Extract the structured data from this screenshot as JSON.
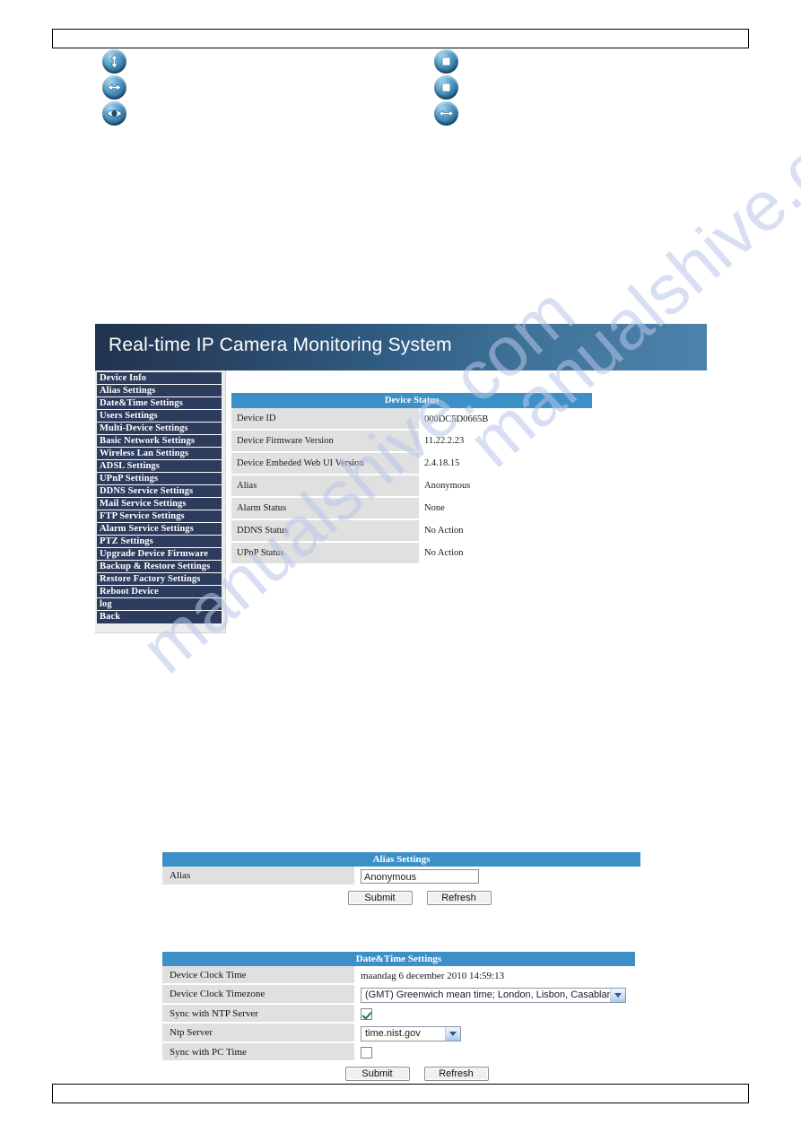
{
  "page": {
    "header_box_text": "",
    "footer_box_text": "",
    "watermark": "manualshive.com"
  },
  "toolbar_icons": {
    "left_group": [
      {
        "name": "vertical-arrow-icon",
        "glyph": "updown"
      },
      {
        "name": "horizontal-arrow-icon",
        "glyph": "leftright"
      },
      {
        "name": "eye-icon",
        "glyph": "eye"
      }
    ],
    "right_group": [
      {
        "name": "stop-square-icon",
        "glyph": "square"
      },
      {
        "name": "stop-square-icon",
        "glyph": "square"
      },
      {
        "name": "horizontal-arrow-icon",
        "glyph": "leftright"
      }
    ]
  },
  "webui": {
    "banner_title": "Real-time IP Camera Monitoring System",
    "sidebar": {
      "items": [
        {
          "label": "Device Info"
        },
        {
          "label": "Alias Settings"
        },
        {
          "label": "Date&Time Settings"
        },
        {
          "label": "Users Settings"
        },
        {
          "label": "Multi-Device Settings"
        },
        {
          "label": "Basic Network Settings"
        },
        {
          "label": "Wireless Lan Settings"
        },
        {
          "label": "ADSL Settings"
        },
        {
          "label": "UPnP Settings"
        },
        {
          "label": "DDNS Service Settings"
        },
        {
          "label": "Mail Service Settings"
        },
        {
          "label": "FTP Service Settings"
        },
        {
          "label": "Alarm Service Settings"
        },
        {
          "label": "PTZ Settings"
        },
        {
          "label": "Upgrade Device Firmware"
        },
        {
          "label": "Backup & Restore Settings"
        },
        {
          "label": "Restore Factory Settings"
        },
        {
          "label": "Reboot Device"
        },
        {
          "label": "log"
        },
        {
          "label": "Back"
        }
      ]
    },
    "device_status": {
      "title": "Device Status",
      "rows": [
        {
          "label": "Device ID",
          "value": "000DC5D0665B"
        },
        {
          "label": "Device Firmware Version",
          "value": "11.22.2.23"
        },
        {
          "label": "Device Embeded Web UI Version",
          "value": "2.4.18.15"
        },
        {
          "label": "Alias",
          "value": "Anonymous"
        },
        {
          "label": "Alarm Status",
          "value": "None"
        },
        {
          "label": "DDNS Status",
          "value": "No Action"
        },
        {
          "label": "UPnP Status",
          "value": "No Action"
        }
      ]
    }
  },
  "alias_settings": {
    "title": "Alias Settings",
    "alias_label": "Alias",
    "alias_value": "Anonymous",
    "submit_label": "Submit",
    "refresh_label": "Refresh"
  },
  "datetime_settings": {
    "title": "Date&Time Settings",
    "clock_time_label": "Device Clock Time",
    "clock_time_value": "maandag 6 december 2010 14:59:13",
    "timezone_label": "Device Clock Timezone",
    "timezone_value": "(GMT) Greenwich mean time; London, Lisbon, Casablan",
    "sync_ntp_label": "Sync with NTP Server",
    "sync_ntp_checked": true,
    "ntp_server_label": "Ntp Server",
    "ntp_server_value": "time.nist.gov",
    "sync_pc_label": "Sync with PC Time",
    "sync_pc_checked": false,
    "submit_label": "Submit",
    "refresh_label": "Refresh"
  },
  "colors": {
    "banner_dark": "#20324e",
    "banner_light": "#4d83ab",
    "panel_header_blue": "#3d90c7",
    "sidebar_navy": "#2d3c5c",
    "row_label_gray": "#e0e0e0",
    "watermark_blue": "#b9c6e8"
  }
}
